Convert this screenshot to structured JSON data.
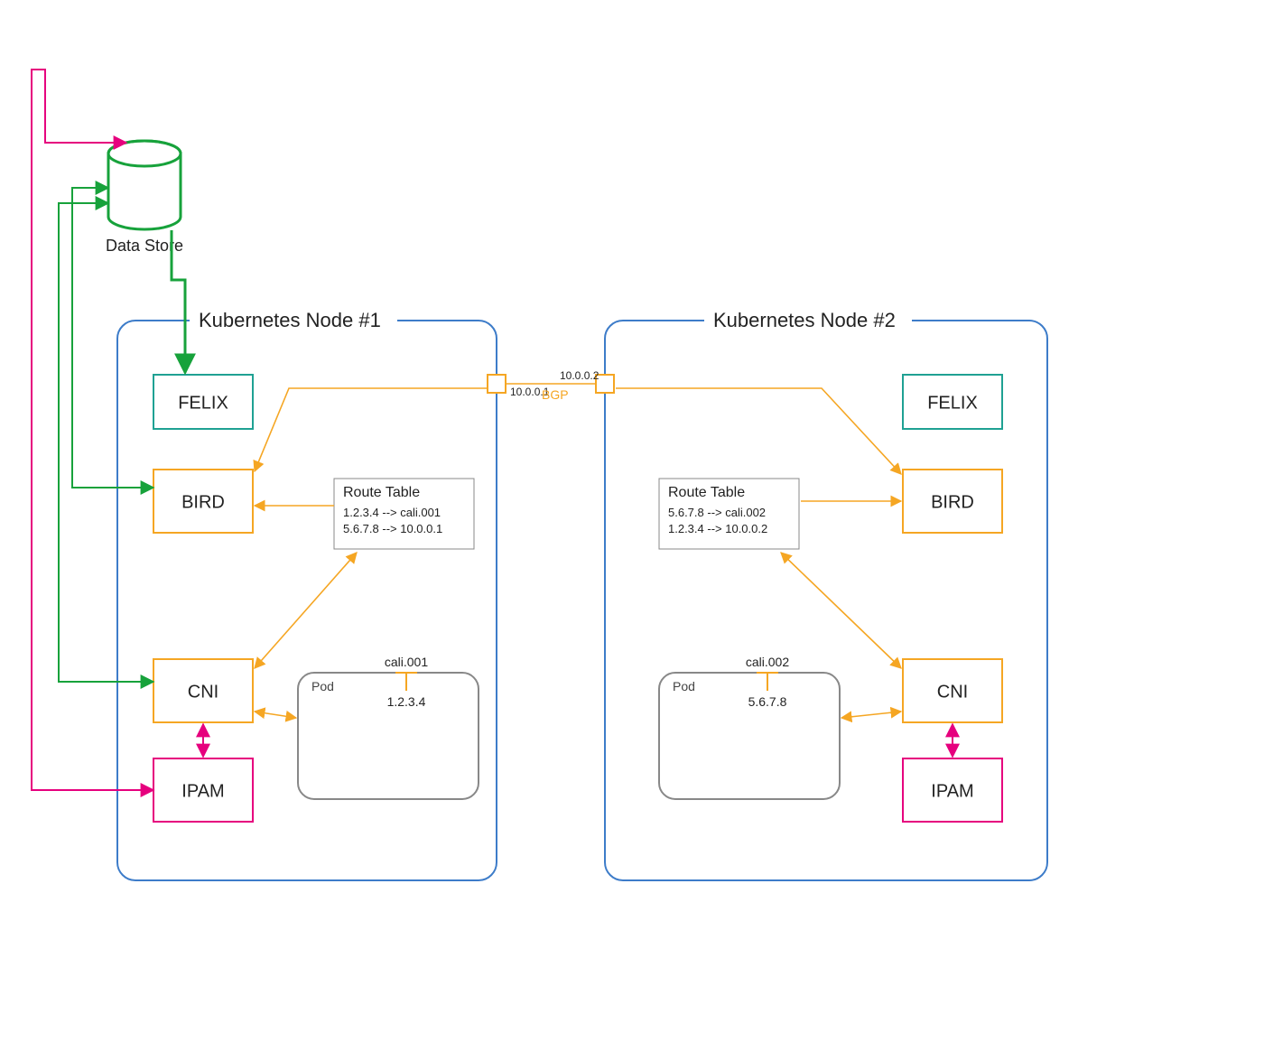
{
  "data_store": {
    "label": "Data Store"
  },
  "bgp": {
    "label": "BGP",
    "port1_ip": "10.0.0.1",
    "port2_ip": "10.0.0.2"
  },
  "node1": {
    "title": "Kubernetes Node #1",
    "felix": "FELIX",
    "bird": "BIRD",
    "cni": "CNI",
    "ipam": "IPAM",
    "route_table": {
      "title": "Route Table",
      "rows": [
        "1.2.3.4 --> cali.001",
        "5.6.7.8 --> 10.0.0.1"
      ]
    },
    "pod": {
      "label": "Pod",
      "iface": "cali.001",
      "ip": "1.2.3.4"
    }
  },
  "node2": {
    "title": "Kubernetes Node #2",
    "felix": "FELIX",
    "bird": "BIRD",
    "cni": "CNI",
    "ipam": "IPAM",
    "route_table": {
      "title": "Route Table",
      "rows": [
        "5.6.7.8 --> cali.002",
        "1.2.3.4 --> 10.0.0.2"
      ]
    },
    "pod": {
      "label": "Pod",
      "iface": "cali.002",
      "ip": "5.6.7.8"
    }
  },
  "colors": {
    "green": "#17a23b",
    "orange": "#f5a623",
    "pink": "#e6007e",
    "teal": "#1fa193",
    "blue": "#3d7cc9",
    "gray": "#888"
  }
}
